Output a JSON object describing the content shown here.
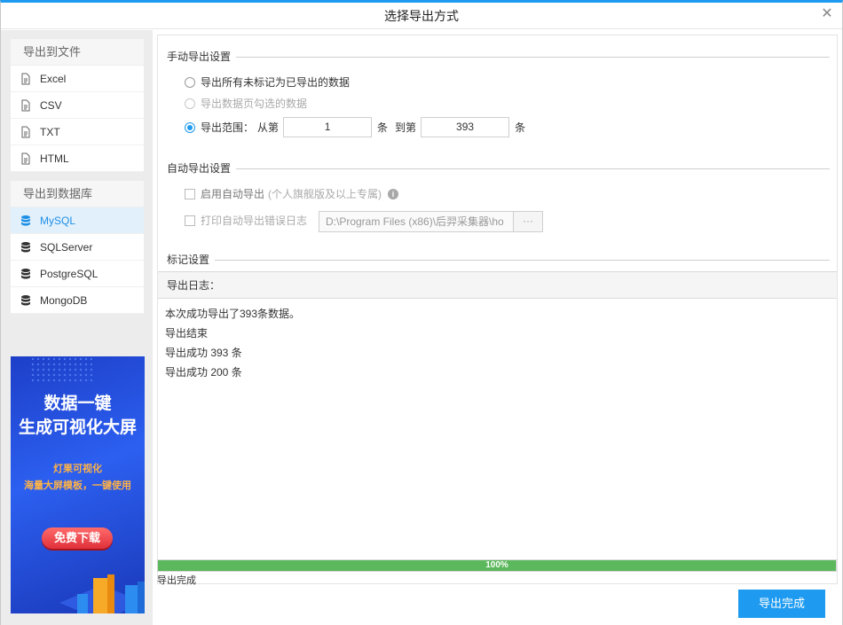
{
  "window": {
    "title": "选择导出方式"
  },
  "sidebar": {
    "file_group": {
      "title": "导出到文件",
      "items": [
        {
          "label": "Excel"
        },
        {
          "label": "CSV"
        },
        {
          "label": "TXT"
        },
        {
          "label": "HTML"
        }
      ]
    },
    "db_group": {
      "title": "导出到数据库",
      "items": [
        {
          "label": "MySQL",
          "active": true
        },
        {
          "label": "SQLServer"
        },
        {
          "label": "PostgreSQL"
        },
        {
          "label": "MongoDB"
        }
      ]
    },
    "banner": {
      "line1": "数据一键",
      "line2": "生成可视化大屏",
      "sub1": "灯果可视化",
      "sub2": "海量大屏模板，一键使用",
      "button": "免费下载"
    }
  },
  "manual": {
    "title": "手动导出设置",
    "opt_all": "导出所有未标记为已导出的数据",
    "opt_page": "导出数据页勾选的数据",
    "opt_range": "导出范围：",
    "from_label": "从第",
    "from_value": "1",
    "unit1": "条",
    "to_label": "到第",
    "to_value": "393",
    "unit2": "条"
  },
  "auto": {
    "title": "自动导出设置",
    "enable_label": "启用自动导出",
    "enable_note": "(个人旗舰版及以上专属)",
    "log_label": "打印自动导出错误日志",
    "log_path": "D:\\Program Files (x86)\\后羿采集器\\ho",
    "browse": "···"
  },
  "mark": {
    "title": "标记设置"
  },
  "log": {
    "title": "导出日志：",
    "lines": [
      "本次成功导出了393条数据。",
      "导出结束",
      "导出成功 393 条",
      "导出成功 200 条"
    ]
  },
  "progress": {
    "percent": 100,
    "label": "100%",
    "status": "导出完成"
  },
  "footer": {
    "done_button": "导出完成"
  },
  "colors": {
    "accent": "#1e9bf0",
    "progress": "#5cb85c"
  }
}
